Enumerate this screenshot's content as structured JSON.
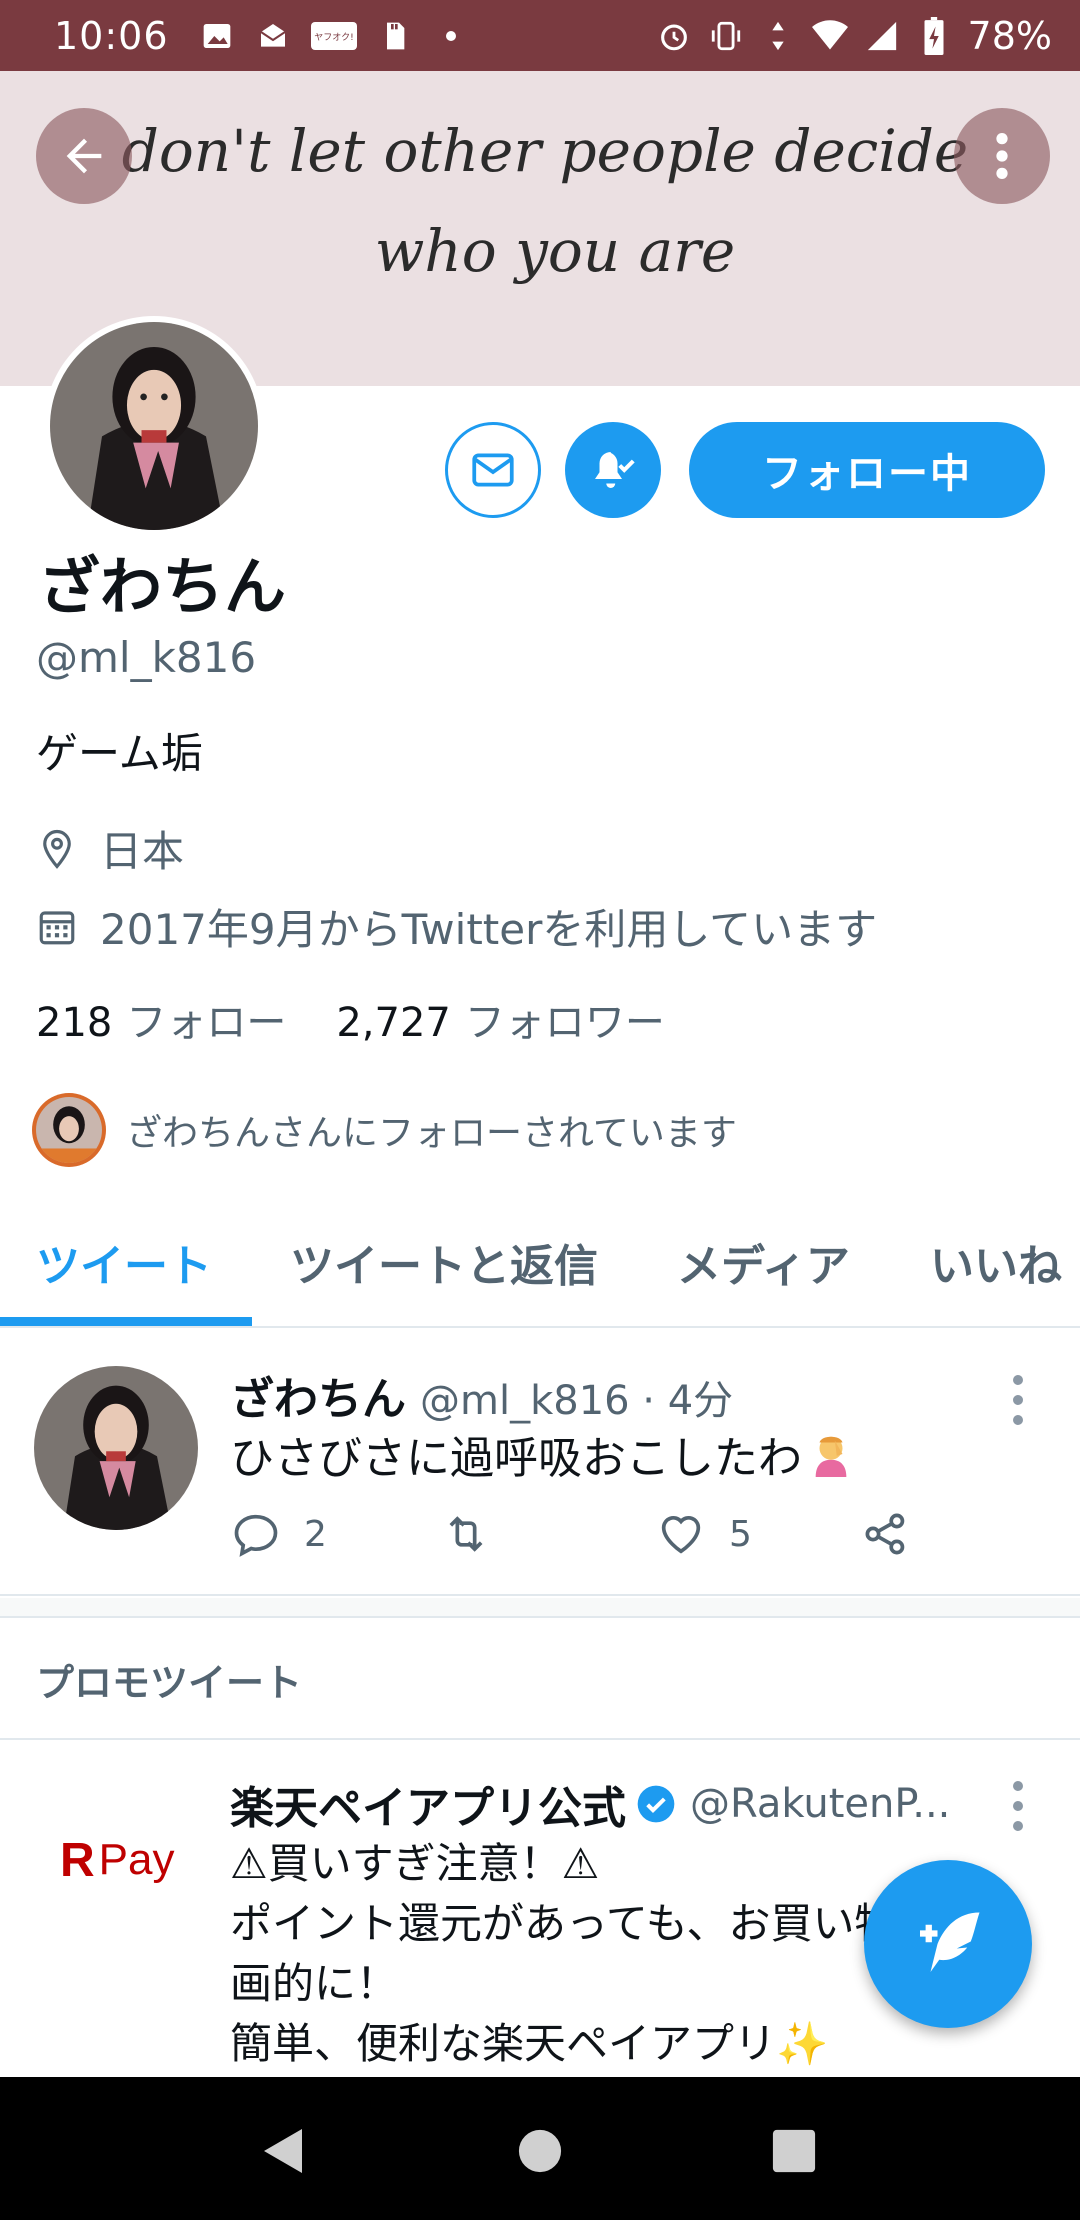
{
  "status_bar": {
    "time": "10:06",
    "battery": "78%",
    "icons": [
      "image-icon",
      "mail-stamp-icon",
      "yahuoku-app-icon",
      "sd-card-icon",
      "dot-icon",
      "alarm-icon",
      "vibrate-icon",
      "data-arrows-icon",
      "wifi-icon",
      "signal-icon",
      "battery-charging-icon"
    ],
    "app_badge_text": "ヤフオク!"
  },
  "banner": {
    "script_line_1": "don't let other people decide",
    "script_line_2": "who you are",
    "background_color": "#ebe0e2"
  },
  "profile": {
    "display_name": "ざわちん",
    "handle": "@ml_k816",
    "bio": "ゲーム垢",
    "location": "日本",
    "joined": "2017年9月からTwitterを利用しています",
    "following_count": "218",
    "following_label": "フォロー",
    "followers_count": "2,727",
    "followers_label": "フォロワー",
    "followed_by_text": "ざわちんさんにフォローされています",
    "follow_button_label": "フォロー中"
  },
  "tabs": [
    {
      "label": "ツイート",
      "active": true
    },
    {
      "label": "ツイートと返信",
      "active": false
    },
    {
      "label": "メディア",
      "active": false
    },
    {
      "label": "いいね",
      "active": false
    }
  ],
  "tweet": {
    "name": "ざわちん",
    "handle_time": "@ml_k816 · 4分",
    "text": "ひさびさに過呼吸おこしたわ",
    "emoji": "facepalm-emoji",
    "reply_count": "2",
    "like_count": "5"
  },
  "promo": {
    "section_label": "プロモツイート",
    "name": "楽天ペイアプリ公式",
    "handle": "@RakutenP...",
    "logo_r": "R",
    "logo_pay": "Pay",
    "lines": [
      "⚠買いすぎ注意！⚠",
      "ポイント還元があっても、お買い物は計",
      "画的に！",
      "簡単、便利な楽天ペイアプリ✨"
    ]
  },
  "colors": {
    "accent": "#1d9bf0",
    "status_bar": "#7a3a40",
    "secondary_text": "#536471"
  }
}
